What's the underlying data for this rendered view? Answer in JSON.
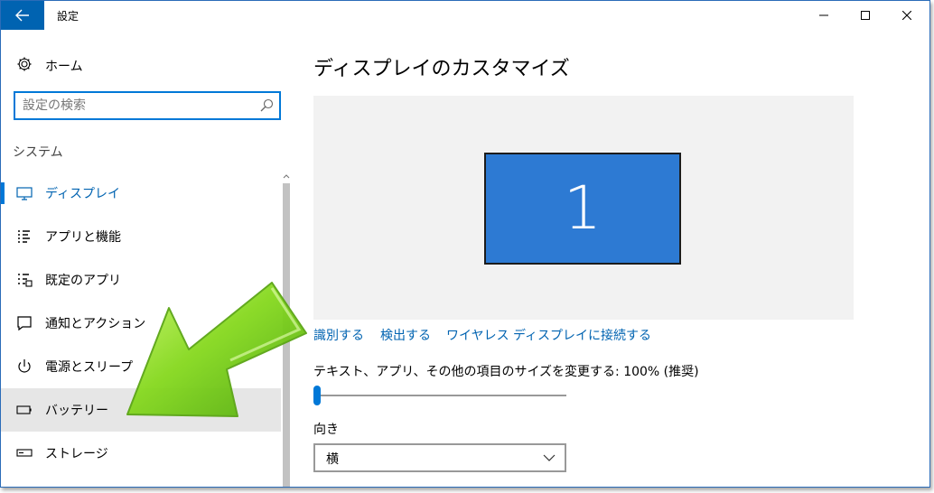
{
  "titlebar": {
    "title": "設定"
  },
  "sidebar": {
    "home_label": "ホーム",
    "search_placeholder": "設定の検索",
    "section_label": "システム",
    "items": [
      {
        "label": "ディスプレイ",
        "icon": "monitor-icon",
        "selected": true
      },
      {
        "label": "アプリと機能",
        "icon": "list-icon"
      },
      {
        "label": "既定のアプリ",
        "icon": "default-apps-icon"
      },
      {
        "label": "通知とアクション",
        "icon": "notification-icon"
      },
      {
        "label": "電源とスリープ",
        "icon": "power-icon"
      },
      {
        "label": "バッテリー",
        "icon": "battery-icon",
        "highlighted": true
      },
      {
        "label": "ストレージ",
        "icon": "storage-icon"
      }
    ]
  },
  "main": {
    "title": "ディスプレイのカスタマイズ",
    "monitor_number": "1",
    "links": {
      "identify": "識別する",
      "detect": "検出する",
      "wireless": "ワイヤレス ディスプレイに接続する"
    },
    "scale_label": "テキスト、アプリ、その他の項目のサイズを変更する: 100% (推奨)",
    "scale_slider_level": 0,
    "orientation_label": "向き",
    "orientation_value": "横"
  },
  "colors": {
    "accent": "#0078d7",
    "titlebar_back": "#0063b1",
    "monitor": "#2d7ad3",
    "link": "#0063b1",
    "annotation_arrow": "#7fd321"
  }
}
